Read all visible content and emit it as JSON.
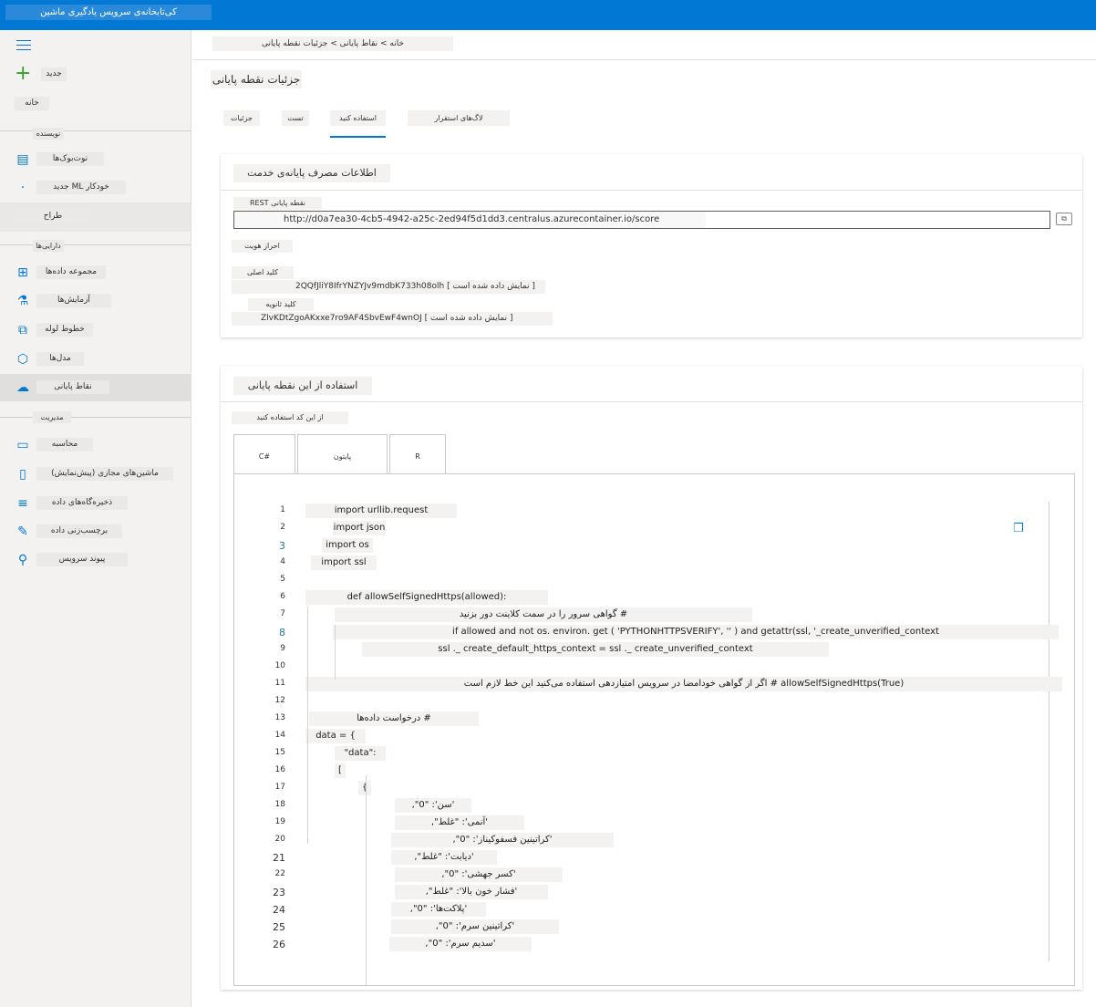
{
  "topbar": {
    "title": "کی‌تابخانه‌ی سرویس یادگیری ماشین"
  },
  "sidebar": {
    "items": [
      {
        "label": "جدید",
        "icon": "plus-icon"
      },
      {
        "label": "خانه",
        "icon": ""
      },
      {
        "label": "نوت‌بوک‌ها",
        "icon": "notebook-icon"
      },
      {
        "label": "خودکار ML جدید",
        "icon": "automl-icon"
      },
      {
        "label": "طراح",
        "icon": "designer-icon"
      },
      {
        "label": "مجموعه داده‌ها",
        "icon": "datasets-icon"
      },
      {
        "label": "آزمایش‌ها",
        "icon": "flask-icon"
      },
      {
        "label": "خطوط لوله",
        "icon": "pipeline-icon"
      },
      {
        "label": "مدل‌ها",
        "icon": "cube-icon"
      },
      {
        "label": "نقاط پایانی",
        "icon": "endpoint-icon"
      },
      {
        "label": "محاسبه",
        "icon": "compute-icon"
      },
      {
        "label": "ماشین‌های مجازی (پیش‌نمایش)",
        "icon": "vm-icon"
      },
      {
        "label": "ذخیره‌گاه‌های داده",
        "icon": "datastore-icon"
      },
      {
        "label": "برچسب‌زنی داده",
        "icon": "labeling-icon"
      },
      {
        "label": "پیوند سرویس",
        "icon": "linked-service-icon"
      }
    ],
    "sections": {
      "author": "نویسنده",
      "assets": "دارایی‌ها",
      "manage": "مدیریت"
    }
  },
  "main": {
    "breadcrumb": "خانه > نقاط پایانی > جزئیات نقطه پایانی",
    "page_title": "جزئیات نقطه پایانی",
    "tabs": [
      "جزئیات",
      "تست",
      "استفاده کنید",
      "لاگ‌های استقرار"
    ],
    "consume_card": {
      "title": "اطلاعات مصرف پایانه‌ی خدمت",
      "rest_label": "نقطه پایانی REST",
      "url": "http://d0a7ea30-4cb5-4942-a25c-2ed94f5d1dd3.centralus.azurecontainer.io/score",
      "copy_label": "کپی",
      "auth_label": "احراز هویت",
      "primary_key_label": "کلید اصلی",
      "primary_key": "2QQfJliY8IfrYNZYJv9mdbK733h08olh [ نمایش داده شده است ]",
      "secondary_key_label": "کلید ثانویه",
      "secondary_key": "ZlvKDtZgoAKxxe7ro9AF4SbvEwF4wnOJ [ نمایش داده شده است ]"
    },
    "code_card": {
      "title": "استفاده از این نقطه پایانی",
      "snippet_label": "از این کد استفاده کنید",
      "code_tabs": [
        "C#",
        "پایتون",
        "R"
      ],
      "lines": [
        "import urllib.request",
        "import json",
        "import os",
        "import ssl",
        "",
        "def allowSelfSignedHttps(allowed):",
        "# گواهی سرور را در سمت کلاینت دور بزنید",
        "if allowed and not os. environ. get ( 'PYTHONHTTPSVERIFY', '' ) and getattr(ssl, '_create_unverified_context",
        "ssl ._ create_default_https_context = ssl ._ create_unverified_context",
        "",
        "allowSelfSignedHttps(True) # اگر از گواهی خودامضا در سرویس امتیازدهی استفاده می‌کنید این خط لازم است",
        "",
        "# درخواست داده‌ها",
        "data = {",
        "\"data\":",
        "[",
        "{",
        "'سن': \"0\",",
        "'آنمی': \"غلط\",",
        "'کراتینین فسفوکیناز': \"0\",",
        "'دیابت': \"غلط\",",
        "'کسر جهشی': \"0\",",
        "'فشار خون بالا': \"غلط\",",
        "'پلاکت‌ها': \"0\",",
        "'کراتینین سرم': \"0\",",
        "'سدیم سرم': \"0\","
      ]
    }
  }
}
